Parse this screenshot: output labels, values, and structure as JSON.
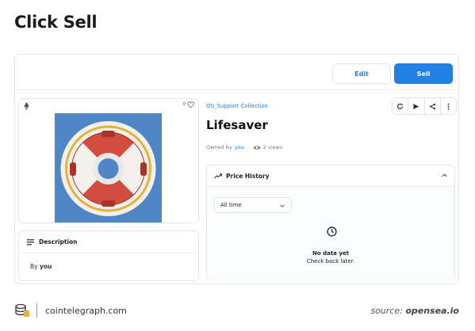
{
  "header": {
    "title": "Click Sell"
  },
  "toolbar": {
    "edit_label": "Edit",
    "sell_label": "Sell"
  },
  "media": {
    "like_count": "0"
  },
  "description": {
    "title": "Description",
    "by_prefix": "By",
    "by_owner": "you"
  },
  "item": {
    "collection": "OS_Support Collection",
    "name": "Lifesaver",
    "owned_prefix": "Owned by",
    "owner": "you",
    "views": "2 views"
  },
  "price_history": {
    "title": "Price History",
    "period": "All time",
    "empty_title": "No data yet",
    "empty_subtitle": "Check back later."
  },
  "footer": {
    "site": "cointelegraph.com",
    "source_prefix": "source:",
    "source_name": "opensea.io"
  },
  "colors": {
    "accent": "#2081e2",
    "art_background": "#4f86c6",
    "ring_red": "#d24c3f",
    "ring_gold": "#e2b33c"
  },
  "icons": [
    "ethereum-icon",
    "heart-icon",
    "lines-icon",
    "refresh-icon",
    "send-icon",
    "share-icon",
    "more-icon",
    "eye-icon",
    "trend-icon",
    "chevron-up-icon",
    "chevron-down-icon",
    "clock-icon",
    "cointelegraph-logo"
  ]
}
